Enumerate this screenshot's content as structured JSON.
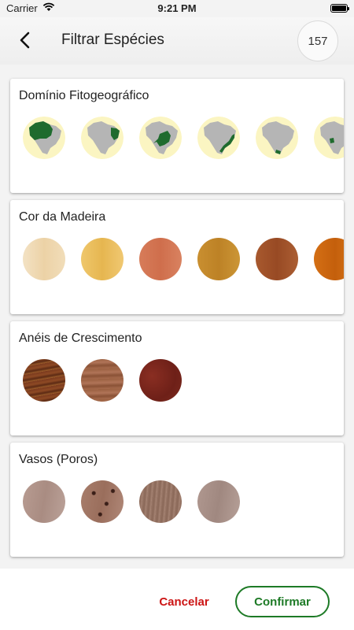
{
  "status_bar": {
    "carrier": "Carrier",
    "time": "9:21 PM"
  },
  "header": {
    "title": "Filtrar Espécies",
    "back_icon": "chevron-left-icon",
    "count": "157"
  },
  "sections": [
    {
      "title": "Domínio Fitogeográfico",
      "items": [
        "brazil-map-amazonia-icon",
        "brazil-map-caatinga-icon",
        "brazil-map-cerrado-icon",
        "brazil-map-mata-atlantica-icon",
        "brazil-map-pampa-icon",
        "brazil-map-pantanal-icon"
      ]
    },
    {
      "title": "Cor da Madeira",
      "items": [
        "#f1dcb8",
        "#edc064",
        "#d67a57",
        "#c8902f",
        "#a4552c",
        "#d06b12"
      ]
    },
    {
      "title": "Anéis de Crescimento",
      "items": [
        "wood-texture-1",
        "wood-texture-2",
        "wood-texture-3"
      ]
    },
    {
      "title": "Vasos (Poros)",
      "items": [
        "wood-texture-4",
        "wood-texture-5",
        "wood-texture-6",
        "wood-texture-7"
      ]
    }
  ],
  "footer": {
    "cancel": "Cancelar",
    "confirm": "Confirmar"
  },
  "colors": {
    "accent_green": "#1d7a26",
    "cancel_red": "#cc1414",
    "map_highlight": "#1f6b2e",
    "map_bg": "#fbf5c2"
  }
}
